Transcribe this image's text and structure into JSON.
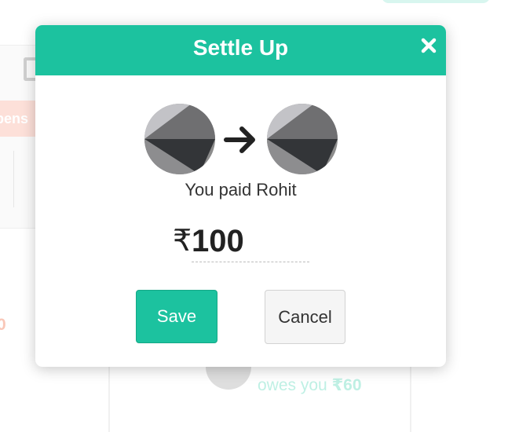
{
  "background": {
    "tag_label": "pens",
    "left_amount": "0",
    "owes_prefix": "owes you ",
    "owes_amount": "₹60"
  },
  "modal": {
    "title": "Settle Up",
    "close_icon": "close-icon",
    "from_avatar_icon": "user-avatar-icon",
    "arrow_icon": "arrow-right-icon",
    "to_avatar_icon": "user-avatar-icon",
    "payment_text": "You paid Rohit",
    "currency_symbol": "₹",
    "amount_value": "100",
    "save_label": "Save",
    "cancel_label": "Cancel"
  },
  "colors": {
    "accent": "#1cc29f",
    "cancel_bg": "#f5f5f5",
    "text": "#333333"
  }
}
